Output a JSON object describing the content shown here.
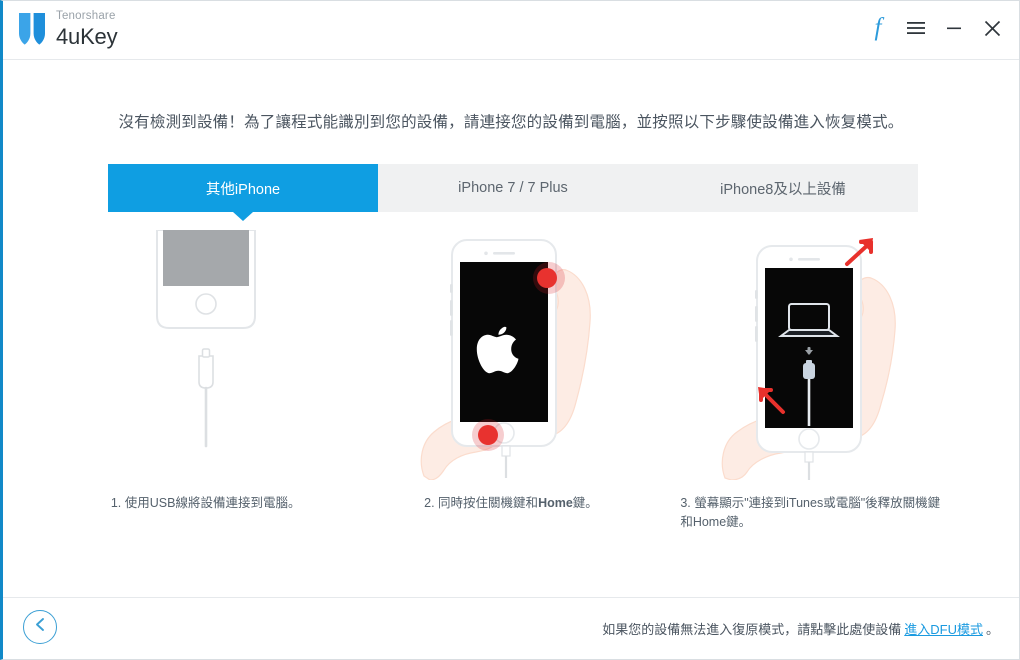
{
  "window": {
    "brand_company": "Tenorshare",
    "brand_product": "4uKey",
    "logo_icon": "shield-logo-icon",
    "controls": {
      "facebook_label": "f",
      "facebook_icon": "facebook-icon",
      "menu_icon": "hamburger-menu-icon",
      "minimize_icon": "minimize-icon",
      "close_icon": "close-icon"
    },
    "accent_color": "#0f9ee2",
    "link_color": "#1a9ae0",
    "edge_color": "#1189c8"
  },
  "main": {
    "headline": "沒有檢測到設備！為了讓程式能識別到您的設備，請連接您的設備到電腦，並按照以下步驟使設備進入恢复模式。",
    "tabs": [
      {
        "label": "其他iPhone",
        "active": true
      },
      {
        "label": "iPhone 7 / 7 Plus",
        "active": false
      },
      {
        "label": "iPhone8及以上設備",
        "active": false
      }
    ],
    "steps": [
      {
        "index": "1",
        "caption": "1. 使用USB線將設備連接到電腦。",
        "art": "iphone-bottom-with-cable-illustration"
      },
      {
        "index": "2",
        "caption_prefix": "2. 同時按住關機鍵和",
        "caption_bold": "Home",
        "caption_suffix": "鍵。",
        "art": "iphone-apple-logo-two-hands-illustration"
      },
      {
        "index": "3",
        "caption": "3. 螢幕顯示\"連接到iTunes或電腦\"後釋放關機鍵和Home鍵。",
        "art": "iphone-connect-to-itunes-release-illustration"
      }
    ]
  },
  "footer": {
    "back_icon": "chevron-left-icon",
    "note_prefix": "如果您的設備無法進入復原模式，請點擊此處使設備",
    "link_label": "進入DFU模式",
    "note_suffix": "。"
  }
}
